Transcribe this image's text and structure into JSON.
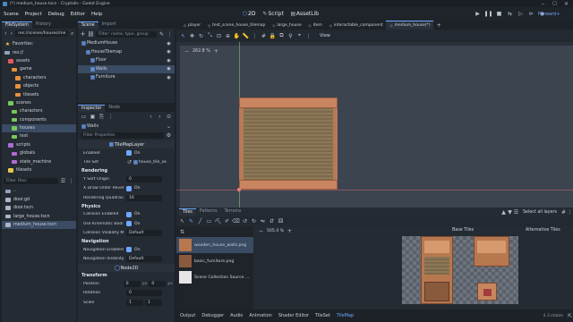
{
  "window": {
    "title": "(*) medium_house.tscn - Cryptalis - Godot Engine"
  },
  "menu": {
    "items": [
      "Scene",
      "Project",
      "Debug",
      "Editor",
      "Help"
    ]
  },
  "workspaces": {
    "tab_2d": "2D",
    "tab_script": "Script",
    "tab_assetlib": "AssetLib",
    "renderer": "Forward+"
  },
  "filesystem": {
    "tabs": [
      "FileSystem",
      "History"
    ],
    "path": "res://scenes/houses/me",
    "filter_placeholder": "Filter Files",
    "tree": [
      {
        "label": "Favorites:",
        "depth": 0,
        "kind": "star",
        "color": "#f0c44a"
      },
      {
        "label": "res://",
        "depth": 0,
        "kind": "folder",
        "color": "#8fa2b8"
      },
      {
        "label": "assets",
        "depth": 1,
        "kind": "folder",
        "color": "#e05c5c"
      },
      {
        "label": "game",
        "depth": 2,
        "kind": "folder",
        "color": "#e8903e"
      },
      {
        "label": "characters",
        "depth": 3,
        "kind": "folder",
        "color": "#e8903e"
      },
      {
        "label": "objects",
        "depth": 3,
        "kind": "folder",
        "color": "#e8903e"
      },
      {
        "label": "tilesets",
        "depth": 3,
        "kind": "folder",
        "color": "#e8903e"
      },
      {
        "label": "scenes",
        "depth": 1,
        "kind": "folder",
        "color": "#77c85a"
      },
      {
        "label": "characters",
        "depth": 2,
        "kind": "folder",
        "color": "#77c85a"
      },
      {
        "label": "components",
        "depth": 2,
        "kind": "folder",
        "color": "#77c85a"
      },
      {
        "label": "houses",
        "depth": 2,
        "kind": "folder",
        "color": "#77c85a",
        "selected": true
      },
      {
        "label": "test",
        "depth": 2,
        "kind": "folder",
        "color": "#77c85a"
      },
      {
        "label": "scripts",
        "depth": 1,
        "kind": "folder",
        "color": "#b26ad8"
      },
      {
        "label": "globals",
        "depth": 2,
        "kind": "folder",
        "color": "#b26ad8"
      },
      {
        "label": "state_machine",
        "depth": 2,
        "kind": "folder",
        "color": "#b26ad8"
      },
      {
        "label": "tilesets",
        "depth": 1,
        "kind": "folder",
        "color": "#e8c84a"
      }
    ],
    "files": [
      {
        "label": "..",
        "color": "#8fa2b8"
      },
      {
        "label": "door.gd",
        "color": "#aab6c5"
      },
      {
        "label": "door.tscn",
        "color": "#aab6c5"
      },
      {
        "label": "large_house.tscn",
        "color": "#aab6c5"
      },
      {
        "label": "medium_house.tscn",
        "color": "#aab6c5",
        "selected": true
      }
    ]
  },
  "scene": {
    "tabs": [
      "Scene",
      "Import"
    ],
    "filter_placeholder": "Filter: name, type, group",
    "nodes": [
      {
        "label": "MediumHouse",
        "depth": 0,
        "color": "#8fa2b8"
      },
      {
        "label": "HouseTilemap",
        "depth": 1,
        "color": "#8fa2b8"
      },
      {
        "label": "Floor",
        "depth": 2,
        "color": "#8fa2b8"
      },
      {
        "label": "Walls",
        "depth": 2,
        "color": "#8fa2b8",
        "selected": true
      },
      {
        "label": "Furniture",
        "depth": 2,
        "color": "#8fa2b8"
      }
    ]
  },
  "inspector": {
    "tabs": [
      "Inspector",
      "Node"
    ],
    "node_name": "Walls",
    "filter_placeholder": "Filter Properties",
    "class_name": "TileMapLayer",
    "enabled": {
      "label": "Enabled",
      "value": "On"
    },
    "tile_set": {
      "label": "Tile Set",
      "value": "house_tile_se"
    },
    "sections": {
      "rendering": "Rendering",
      "physics": "Physics",
      "navigation": "Navigation",
      "node2d": "Node2D",
      "transform": "Transform"
    },
    "rendering": [
      {
        "label": "Y Sort Origin",
        "value": "0"
      },
      {
        "label": "X Draw Order Rever",
        "value": "On"
      },
      {
        "label": "Rendering Quadran",
        "value": "16"
      }
    ],
    "physics": [
      {
        "label": "Collision Enabled",
        "value": "On"
      },
      {
        "label": "Use Kinematic Bodi",
        "value": "On"
      },
      {
        "label": "Collision Visibility M",
        "value": "Default"
      }
    ],
    "navigation": [
      {
        "label": "Navigation Enabled",
        "value": "On"
      },
      {
        "label": "Navigation Visibility",
        "value": "Default"
      }
    ],
    "transform": [
      {
        "label": "Position",
        "x": "0",
        "y": "0",
        "unit": "px"
      },
      {
        "label": "Rotation",
        "value": "0"
      },
      {
        "label": "Scale",
        "x": "1",
        "y": "1"
      }
    ]
  },
  "editor_tabs": [
    "player",
    "test_scene_house_tilemap",
    "large_house",
    "item",
    "interactable_component",
    "medium_house(*)"
  ],
  "viewport": {
    "zoom": "262.8 %",
    "view_label": "View"
  },
  "tiles_panel": {
    "tabs": [
      "Tiles",
      "Patterns",
      "Terrains"
    ],
    "select_all_layers": "Select all layers",
    "zoom": "505.4 %",
    "base_tiles": "Base Tiles",
    "alternative_tiles": "Alternative Tiles",
    "sources": [
      {
        "label": "wooden_house_walls.png",
        "selected": true
      },
      {
        "label": "basic_furniture.png"
      },
      {
        "label": "Scene Collection Source ..."
      }
    ]
  },
  "bottom_bar": {
    "tabs": [
      "Output",
      "Debugger",
      "Audio",
      "Animation",
      "Shader Editor",
      "TileSet",
      "TileMap"
    ],
    "version": "4.3.stable"
  }
}
